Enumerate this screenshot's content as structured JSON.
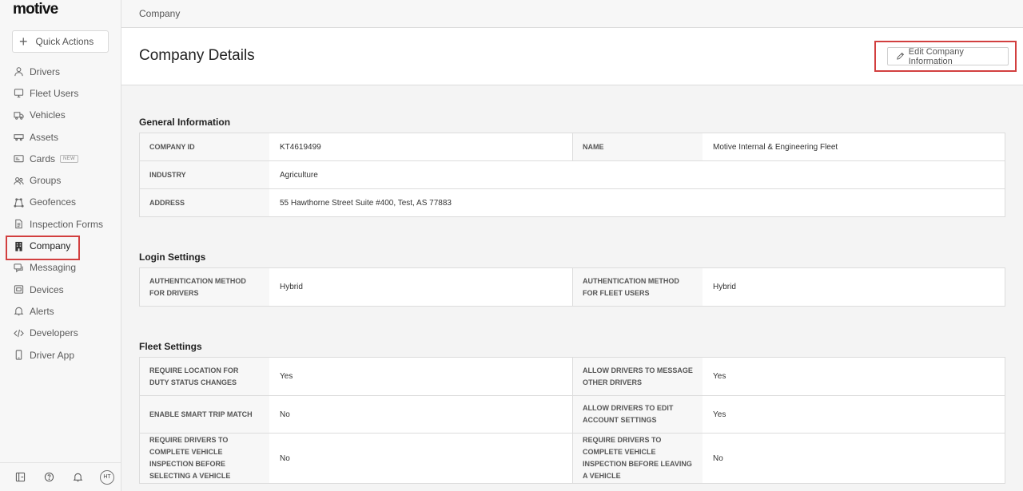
{
  "app": {
    "logo": "motive"
  },
  "sidebar": {
    "quick_actions": "Quick Actions",
    "items": [
      {
        "label": "Drivers",
        "icon": "user-icon"
      },
      {
        "label": "Fleet Users",
        "icon": "monitor-icon"
      },
      {
        "label": "Vehicles",
        "icon": "truck-icon"
      },
      {
        "label": "Assets",
        "icon": "trailer-icon"
      },
      {
        "label": "Cards",
        "icon": "card-icon",
        "badge": "NEW"
      },
      {
        "label": "Groups",
        "icon": "users-icon"
      },
      {
        "label": "Geofences",
        "icon": "geofence-icon"
      },
      {
        "label": "Inspection Forms",
        "icon": "document-icon"
      },
      {
        "label": "Company",
        "icon": "building-icon",
        "active": true
      },
      {
        "label": "Messaging",
        "icon": "chat-icon"
      },
      {
        "label": "Devices",
        "icon": "device-icon"
      },
      {
        "label": "Alerts",
        "icon": "bell-icon"
      },
      {
        "label": "Developers",
        "icon": "code-icon"
      },
      {
        "label": "Driver App",
        "icon": "phone-icon"
      }
    ],
    "footer": {
      "avatar": "HT"
    }
  },
  "breadcrumb": "Company",
  "header": {
    "title": "Company Details",
    "edit_button": "Edit Company Information"
  },
  "general": {
    "title": "General Information",
    "company_id_label": "COMPANY ID",
    "company_id": "KT4619499",
    "name_label": "NAME",
    "name": "Motive Internal & Engineering Fleet",
    "industry_label": "INDUSTRY",
    "industry": "Agriculture",
    "address_label": "ADDRESS",
    "address": "55 Hawthorne Street Suite #400, Test, AS 77883"
  },
  "login": {
    "title": "Login Settings",
    "drivers_label": "AUTHENTICATION METHOD FOR DRIVERS",
    "drivers": "Hybrid",
    "fleet_label": "AUTHENTICATION METHOD FOR FLEET USERS",
    "fleet": "Hybrid"
  },
  "fleet": {
    "title": "Fleet Settings",
    "rows": [
      {
        "l1": "REQUIRE LOCATION FOR DUTY STATUS CHANGES",
        "v1": "Yes",
        "l2": "ALLOW DRIVERS TO MESSAGE OTHER DRIVERS",
        "v2": "Yes"
      },
      {
        "l1": "ENABLE SMART TRIP MATCH",
        "v1": "No",
        "l2": "ALLOW DRIVERS TO EDIT ACCOUNT SETTINGS",
        "v2": "Yes"
      },
      {
        "l1": "REQUIRE DRIVERS TO COMPLETE VEHICLE INSPECTION BEFORE SELECTING A VEHICLE",
        "v1": "No",
        "l2": "REQUIRE DRIVERS TO COMPLETE VEHICLE INSPECTION BEFORE LEAVING A VEHICLE",
        "v2": "No"
      }
    ]
  }
}
